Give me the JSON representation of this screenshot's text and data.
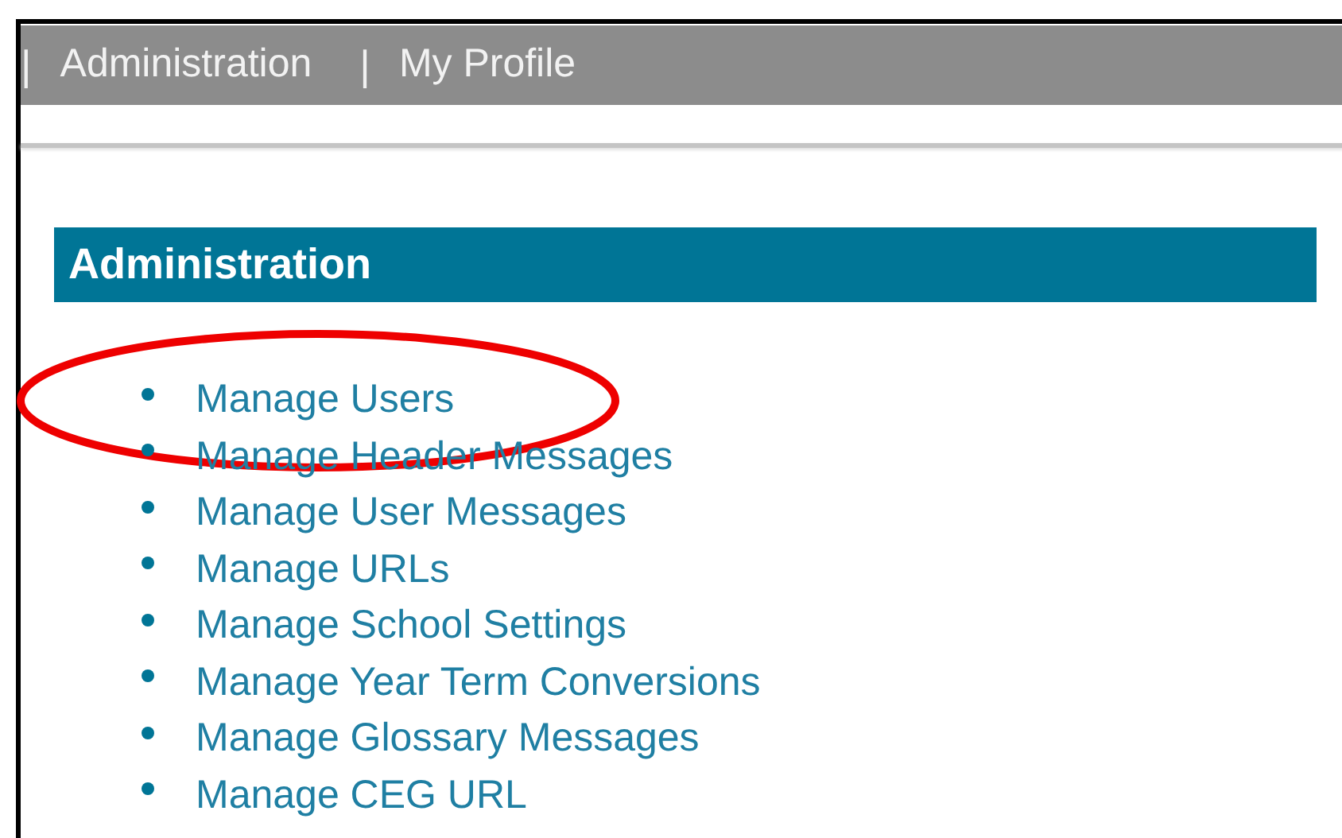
{
  "nav": [
    {
      "separator": "|",
      "label": "Administration"
    },
    {
      "separator": "|",
      "label": "My Profile"
    }
  ],
  "section": {
    "title": "Administration"
  },
  "links": [
    {
      "label": "Manage Users",
      "circled": true
    },
    {
      "label": "Manage Header Messages",
      "circled": false
    },
    {
      "label": "Manage User Messages",
      "circled": false
    },
    {
      "label": "Manage URLs",
      "circled": false
    },
    {
      "label": "Manage School Settings",
      "circled": false
    },
    {
      "label": "Manage Year Term Conversions",
      "circled": false
    },
    {
      "label": "Manage Glossary Messages",
      "circled": false
    },
    {
      "label": "Manage CEG URL",
      "circled": false
    }
  ]
}
